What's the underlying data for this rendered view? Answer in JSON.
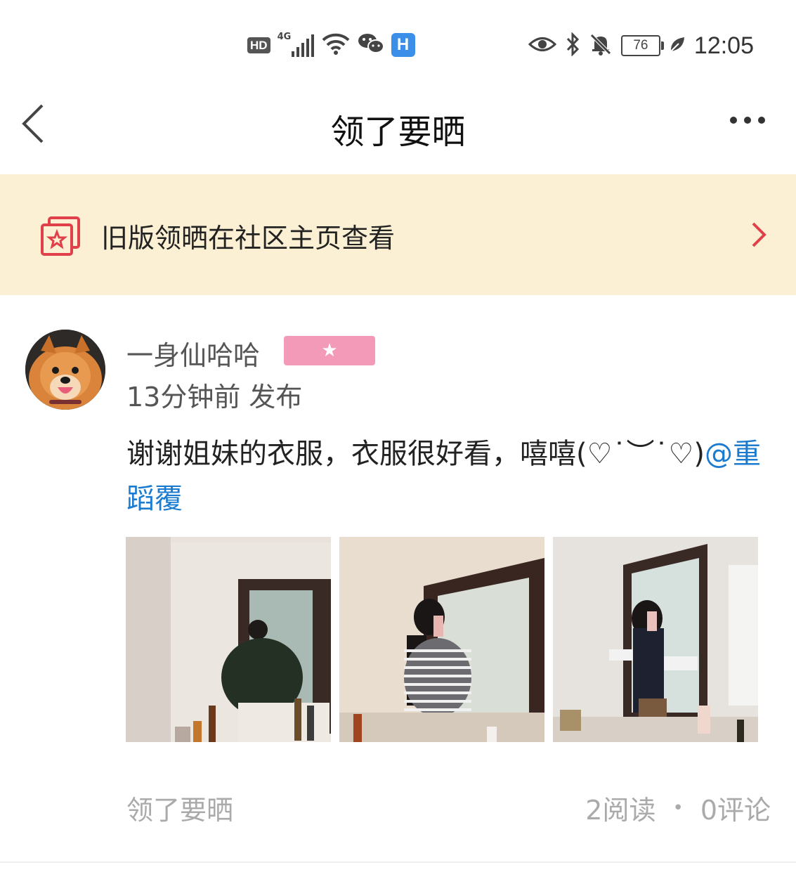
{
  "status_bar": {
    "hd": "HD",
    "network": "4G",
    "time": "12:05",
    "battery": "76"
  },
  "header": {
    "title": "领了要晒"
  },
  "banner": {
    "text": "旧版领晒在社区主页查看"
  },
  "post": {
    "username": "一身仙哈哈",
    "badge_icon": "star-icon",
    "time": "13分钟前 发布",
    "content_text": "谢谢姐妹的衣服，衣服很好看，嘻嘻(♡˙︶˙♡)",
    "mention": "@重蹈覆",
    "photos": [
      {
        "name": "photo-1"
      },
      {
        "name": "photo-2"
      },
      {
        "name": "photo-3"
      }
    ],
    "tag": "领了要晒",
    "reads": "2阅读",
    "separator": "•",
    "comments": "0评论"
  },
  "colors": {
    "banner_bg": "#fbf0d4",
    "accent_red": "#e0404a",
    "mention_blue": "#1a7bd0",
    "badge_pink": "#f39ab8"
  }
}
